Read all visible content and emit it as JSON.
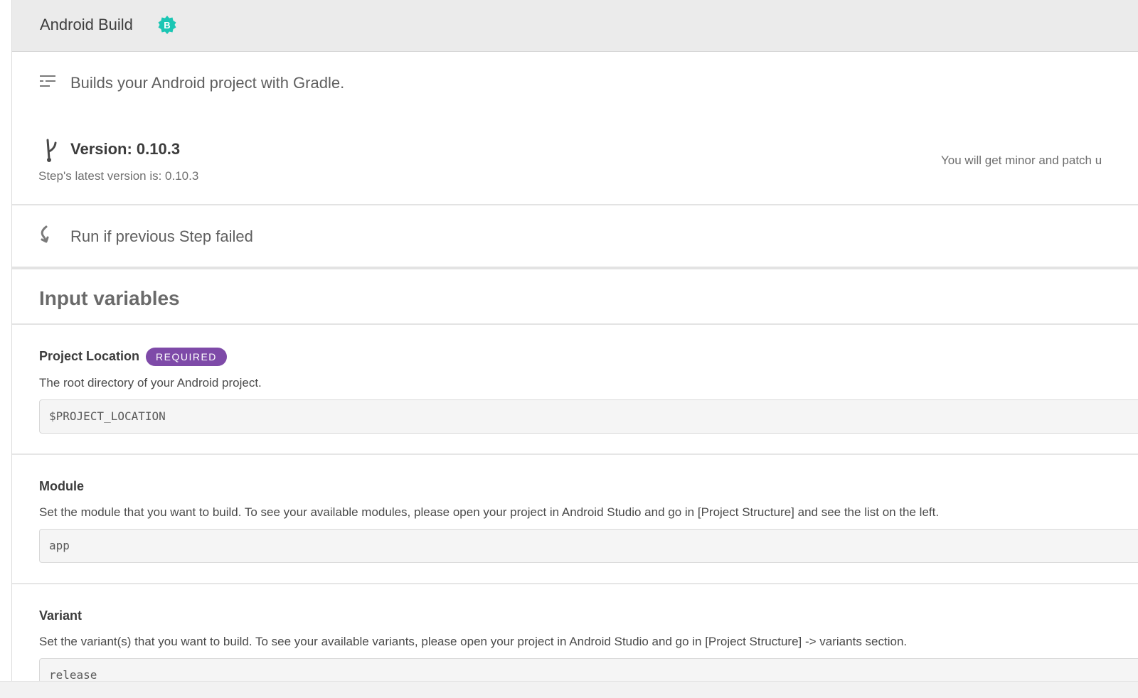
{
  "header": {
    "title": "Android Build",
    "badge_letter": "B",
    "badge_color": "#1bc6b4"
  },
  "description": {
    "text": "Builds your Android project with Gradle."
  },
  "version": {
    "title": "Version: 0.10.3",
    "latest": "Step's latest version is: 0.10.3",
    "update_note": "You will get minor and patch u"
  },
  "run_if": {
    "text": "Run if previous Step failed"
  },
  "inputs": {
    "title": "Input variables",
    "required_label": "REQUIRED",
    "required_color": "#7e4aa8",
    "fields": [
      {
        "label": "Project Location",
        "description": "The root directory of your Android project.",
        "value": "$PROJECT_LOCATION"
      },
      {
        "label": "Module",
        "description": "Set the module that you want to build. To see your available modules, please open your project in Android Studio and go in [Project Structure] and see the list on the left.",
        "value": "app"
      },
      {
        "label": "Variant",
        "description": "Set the variant(s) that you want to build. To see your available variants, please open your project in Android Studio and go in [Project Structure] -> variants section.",
        "value": "release"
      }
    ]
  }
}
